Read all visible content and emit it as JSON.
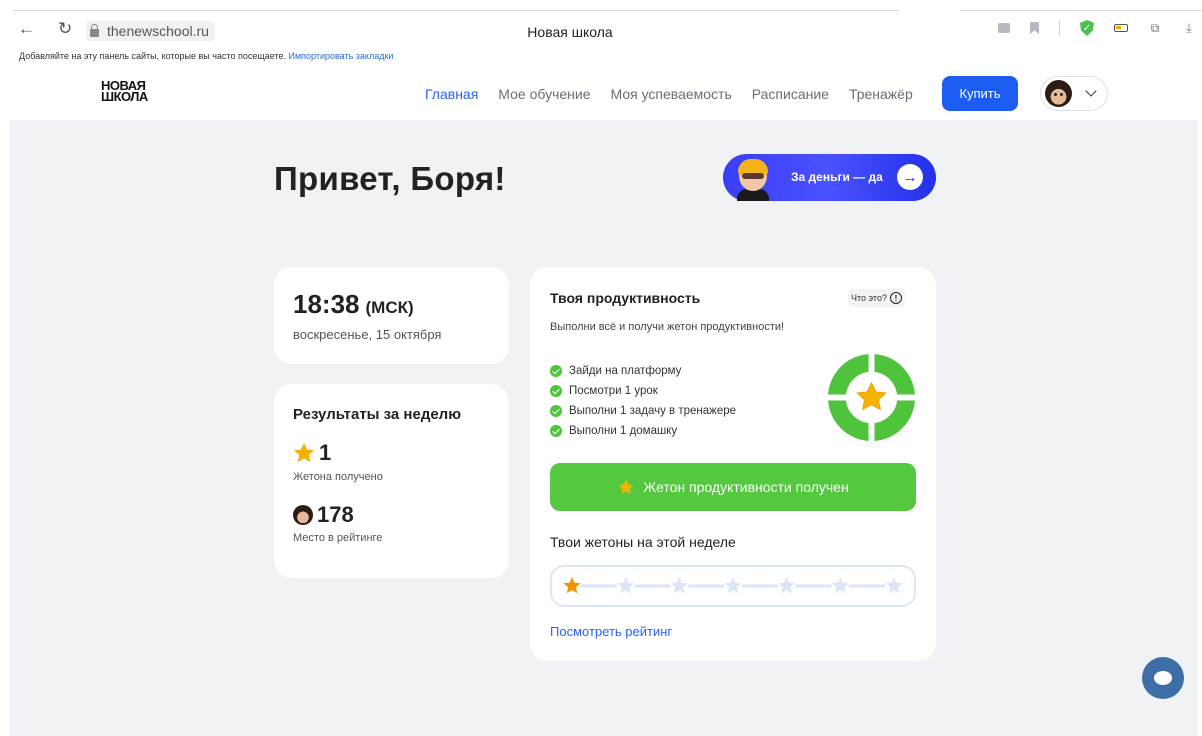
{
  "browser": {
    "url": "thenewschool.ru",
    "tab_title": "Новая школа",
    "bookmarks_text": "Добавляйте на эту панель сайты, которые вы часто посещаете.",
    "bookmarks_link": "Импортировать закладки"
  },
  "header": {
    "logo_line1": "НОВАЯ",
    "logo_line2": "ШКОЛА",
    "nav": [
      "Главная",
      "Мое обучение",
      "Моя успеваемость",
      "Расписание",
      "Тренажёр"
    ],
    "active_nav": "Главная",
    "buy_label": "Купить"
  },
  "main": {
    "greeting": "Привет, Боря!",
    "promo_label": "За деньги — да",
    "time": "18:38",
    "timezone": "(МСК)",
    "date": "воскресенье, 15 октября",
    "results": {
      "title": "Результаты за неделю",
      "tokens_value": "1",
      "tokens_label": "Жетона получено",
      "rank_value": "178",
      "rank_label": "Место в рейтинге"
    },
    "productivity": {
      "title": "Твоя продуктивность",
      "what_label": "Что это?",
      "subtitle": "Выполни всё и получи жетон продуктивности!",
      "tasks": [
        "Зайди на платформу",
        "Посмотри 1 урок",
        "Выполни 1 задачу в тренажере",
        "Выполни 1 домашку"
      ],
      "token_button": "Жетон продуктивности получен",
      "week_title": "Твои жетоны на этой неделе",
      "week_tokens_earned": 1,
      "week_tokens_total": 7,
      "rating_link": "Посмотреть рейтинг"
    }
  },
  "colors": {
    "accent_blue": "#1d5cf0",
    "success_green": "#54c83f",
    "page_bg": "#f0f2f5",
    "star": "#f5b301"
  }
}
